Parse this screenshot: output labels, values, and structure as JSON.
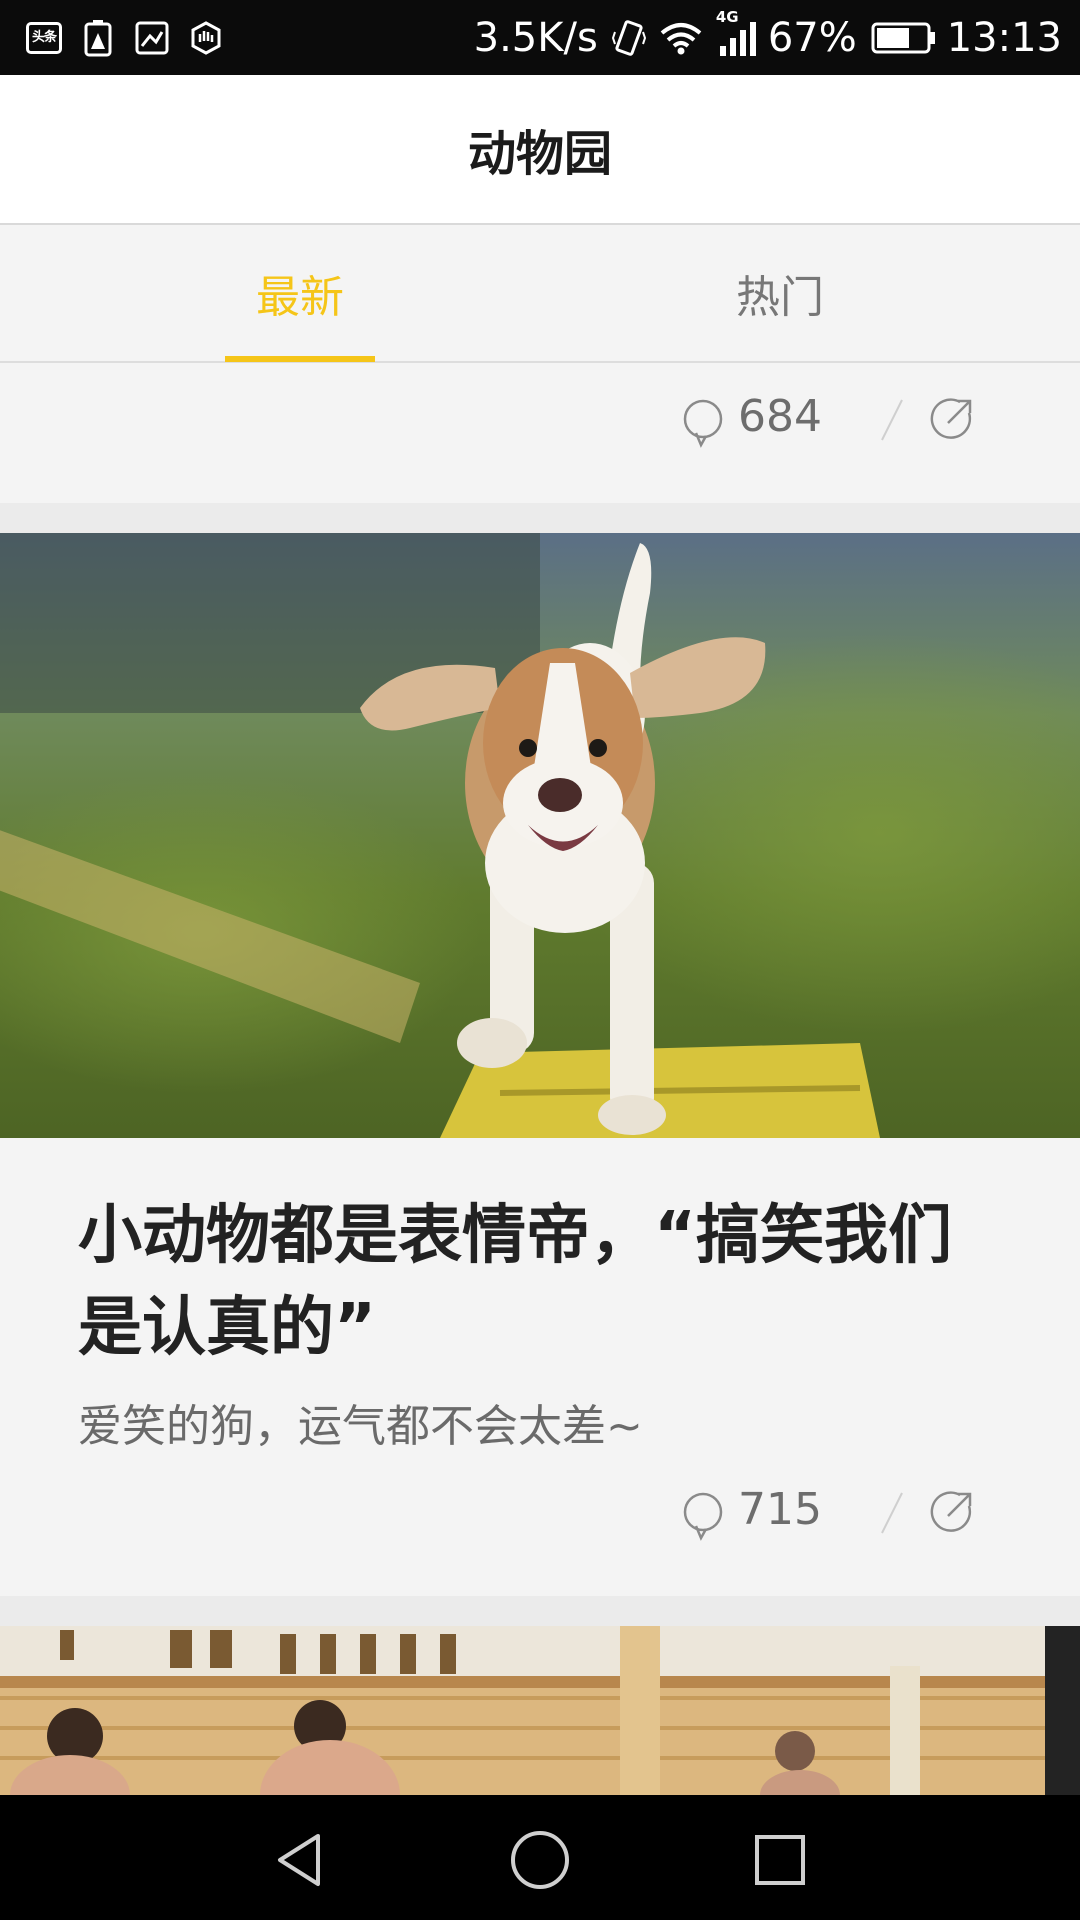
{
  "status_bar": {
    "toutiao_label": "头条",
    "network_speed": "3.5K/s",
    "network_type": "4G",
    "battery_percent": "67%",
    "battery_level": 0.67,
    "time": "13:13"
  },
  "header": {
    "title": "动物园"
  },
  "tabs": [
    {
      "label": "最新",
      "active": true
    },
    {
      "label": "热门",
      "active": false
    }
  ],
  "posts": [
    {
      "comment_count": "684"
    },
    {
      "title": "小动物都是表情帝，“搞笑我们是认真的”",
      "subtitle": "爱笑的狗，运气都不会太差~",
      "comment_count": "715"
    }
  ],
  "colors": {
    "accent": "#f5c518",
    "background": "#f4f4f4",
    "title_text": "#222222",
    "meta_text": "#6d6d6d"
  },
  "icons": {
    "comment": "comment-icon",
    "share": "share-icon",
    "nav_back": "back-triangle-icon",
    "nav_home": "home-circle-icon",
    "nav_recents": "recents-square-icon"
  }
}
